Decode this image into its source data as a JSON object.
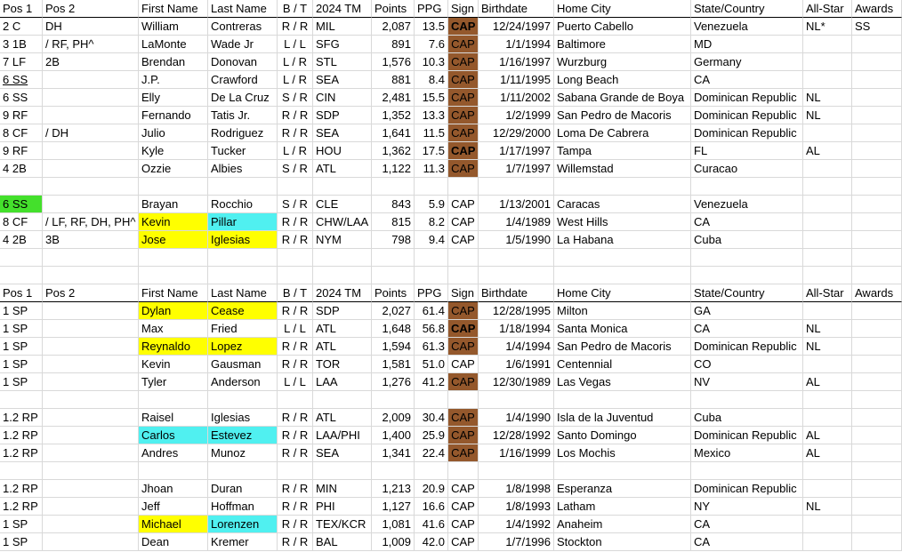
{
  "headers": [
    "Pos 1",
    "Pos 2",
    "First Name",
    "Last Name",
    "B / T",
    "2024 TM",
    "Points",
    "PPG",
    "Sign",
    "Birthdate",
    "Home City",
    "State/Country",
    "All-Star",
    "Awards"
  ],
  "colors": {
    "cap_fill": "#94582c",
    "yellow_highlight": "#ffff00",
    "cyan_highlight": "#50f0f0",
    "green_highlight": "#44e02c",
    "gridline": "#d9d9d9"
  },
  "section1_rows": [
    {
      "pos1": "2 C",
      "pos2": "DH",
      "first": "William",
      "last": "Contreras",
      "bt": "R / R",
      "tm": "MIL",
      "points": "2,087",
      "ppg": "13.5",
      "sign": "CAP",
      "birth": "12/24/1997",
      "city": "Puerto Cabello",
      "state": "Venezuela",
      "allstar": "NL*",
      "awards": "SS"
    },
    {
      "pos1": "3 1B",
      "pos2": "/ RF, PH^",
      "first": "LaMonte",
      "last": "Wade Jr",
      "bt": "L / L",
      "tm": "SFG",
      "points": "891",
      "ppg": "7.6",
      "sign": "CAP",
      "birth": "1/1/1994",
      "city": "Baltimore",
      "state": "MD",
      "allstar": "",
      "awards": ""
    },
    {
      "pos1": "7 LF",
      "pos2": "2B",
      "first": "Brendan",
      "last": "Donovan",
      "bt": "L / R",
      "tm": "STL",
      "points": "1,576",
      "ppg": "10.3",
      "sign": "CAP",
      "birth": "1/16/1997",
      "city": "Wurzburg",
      "state": "Germany",
      "allstar": "",
      "awards": ""
    },
    {
      "pos1": "6 SS",
      "pos2": "",
      "first": "J.P.",
      "last": "Crawford",
      "bt": "L / R",
      "tm": "SEA",
      "points": "881",
      "ppg": "8.4",
      "sign": "CAP",
      "birth": "1/11/1995",
      "city": "Long Beach",
      "state": "CA",
      "allstar": "",
      "awards": ""
    },
    {
      "pos1": "6 SS",
      "pos2": "",
      "first": "Elly",
      "last": "De La Cruz",
      "bt": "S / R",
      "tm": "CIN",
      "points": "2,481",
      "ppg": "15.5",
      "sign": "CAP",
      "birth": "1/11/2002",
      "city": "Sabana Grande de Boya",
      "state": "Dominican Republic",
      "allstar": "NL",
      "awards": ""
    },
    {
      "pos1": "9 RF",
      "pos2": "",
      "first": "Fernando",
      "last": "Tatis Jr.",
      "bt": "R / R",
      "tm": "SDP",
      "points": "1,352",
      "ppg": "13.3",
      "sign": "CAP",
      "birth": "1/2/1999",
      "city": "San Pedro de Macoris",
      "state": "Dominican Republic",
      "allstar": "NL",
      "awards": ""
    },
    {
      "pos1": "8 CF",
      "pos2": "/ DH",
      "first": "Julio",
      "last": "Rodriguez",
      "bt": "R / R",
      "tm": "SEA",
      "points": "1,641",
      "ppg": "11.5",
      "sign": "CAP",
      "birth": "12/29/2000",
      "city": "Loma De Cabrera",
      "state": "Dominican Republic",
      "allstar": "",
      "awards": ""
    },
    {
      "pos1": "9 RF",
      "pos2": "",
      "first": "Kyle",
      "last": "Tucker",
      "bt": "L / R",
      "tm": "HOU",
      "points": "1,362",
      "ppg": "17.5",
      "sign": "CAP",
      "birth": "1/17/1997",
      "city": "Tampa",
      "state": "FL",
      "allstar": "AL",
      "awards": ""
    },
    {
      "pos1": "4 2B",
      "pos2": "",
      "first": "Ozzie",
      "last": "Albies",
      "bt": "S / R",
      "tm": "ATL",
      "points": "1,122",
      "ppg": "11.3",
      "sign": "CAP",
      "birth": "1/7/1997",
      "city": "Willemstad",
      "state": "Curacao",
      "allstar": "",
      "awards": ""
    }
  ],
  "bench_rows": [
    {
      "pos1": "6 SS",
      "pos2": "",
      "first": "Brayan",
      "last": "Rocchio",
      "bt": "S / R",
      "tm": "CLE",
      "points": "843",
      "ppg": "5.9",
      "sign": "CAP",
      "birth": "1/13/2001",
      "city": "Caracas",
      "state": "Venezuela",
      "allstar": "",
      "awards": ""
    },
    {
      "pos1": "8 CF",
      "pos2": "/ LF, RF, DH, PH^",
      "first": "Kevin",
      "last": "Pillar",
      "bt": "R / R",
      "tm": "CHW/LAA",
      "points": "815",
      "ppg": "8.2",
      "sign": "CAP",
      "birth": "1/4/1989",
      "city": "West Hills",
      "state": "CA",
      "allstar": "",
      "awards": ""
    },
    {
      "pos1": "4 2B",
      "pos2": "3B",
      "first": "Jose",
      "last": "Iglesias",
      "bt": "R / R",
      "tm": "NYM",
      "points": "798",
      "ppg": "9.4",
      "sign": "CAP",
      "birth": "1/5/1990",
      "city": "La Habana",
      "state": "Cuba",
      "allstar": "",
      "awards": ""
    }
  ],
  "sp_rows": [
    {
      "pos1": "1 SP",
      "pos2": "",
      "first": "Dylan",
      "last": "Cease",
      "bt": "R / R",
      "tm": "SDP",
      "points": "2,027",
      "ppg": "61.4",
      "sign": "CAP",
      "birth": "12/28/1995",
      "city": "Milton",
      "state": "GA",
      "allstar": "",
      "awards": ""
    },
    {
      "pos1": "1 SP",
      "pos2": "",
      "first": "Max",
      "last": "Fried",
      "bt": "L / L",
      "tm": "ATL",
      "points": "1,648",
      "ppg": "56.8",
      "sign": "CAP",
      "birth": "1/18/1994",
      "city": "Santa Monica",
      "state": "CA",
      "allstar": "NL",
      "awards": ""
    },
    {
      "pos1": "1 SP",
      "pos2": "",
      "first": "Reynaldo",
      "last": "Lopez",
      "bt": "R / R",
      "tm": "ATL",
      "points": "1,594",
      "ppg": "61.3",
      "sign": "CAP",
      "birth": "1/4/1994",
      "city": "San Pedro de Macoris",
      "state": "Dominican Republic",
      "allstar": "NL",
      "awards": ""
    },
    {
      "pos1": "1 SP",
      "pos2": "",
      "first": "Kevin",
      "last": "Gausman",
      "bt": "R / R",
      "tm": "TOR",
      "points": "1,581",
      "ppg": "51.0",
      "sign": "CAP",
      "birth": "1/6/1991",
      "city": "Centennial",
      "state": "CO",
      "allstar": "",
      "awards": ""
    },
    {
      "pos1": "1 SP",
      "pos2": "",
      "first": "Tyler",
      "last": "Anderson",
      "bt": "L / L",
      "tm": "LAA",
      "points": "1,276",
      "ppg": "41.2",
      "sign": "CAP",
      "birth": "12/30/1989",
      "city": "Las Vegas",
      "state": "NV",
      "allstar": "AL",
      "awards": ""
    }
  ],
  "rp_rows": [
    {
      "pos1": "1.2 RP",
      "pos2": "",
      "first": "Raisel",
      "last": "Iglesias",
      "bt": "R / R",
      "tm": "ATL",
      "points": "2,009",
      "ppg": "30.4",
      "sign": "CAP",
      "birth": "1/4/1990",
      "city": "Isla de la Juventud",
      "state": "Cuba",
      "allstar": "",
      "awards": ""
    },
    {
      "pos1": "1.2 RP",
      "pos2": "",
      "first": "Carlos",
      "last": "Estevez",
      "bt": "R / R",
      "tm": "LAA/PHI",
      "points": "1,400",
      "ppg": "25.9",
      "sign": "CAP",
      "birth": "12/28/1992",
      "city": "Santo Domingo",
      "state": "Dominican Republic",
      "allstar": "AL",
      "awards": ""
    },
    {
      "pos1": "1.2 RP",
      "pos2": "",
      "first": "Andres",
      "last": "Munoz",
      "bt": "R / R",
      "tm": "SEA",
      "points": "1,341",
      "ppg": "22.4",
      "sign": "CAP",
      "birth": "1/16/1999",
      "city": "Los Mochis",
      "state": "Mexico",
      "allstar": "AL",
      "awards": ""
    }
  ],
  "bottom_rows": [
    {
      "pos1": "1.2 RP",
      "pos2": "",
      "first": "Jhoan",
      "last": "Duran",
      "bt": "R / R",
      "tm": "MIN",
      "points": "1,213",
      "ppg": "20.9",
      "sign": "CAP",
      "birth": "1/8/1998",
      "city": "Esperanza",
      "state": "Dominican Republic",
      "allstar": "",
      "awards": ""
    },
    {
      "pos1": "1.2 RP",
      "pos2": "",
      "first": "Jeff",
      "last": "Hoffman",
      "bt": "R / R",
      "tm": "PHI",
      "points": "1,127",
      "ppg": "16.6",
      "sign": "CAP",
      "birth": "1/8/1993",
      "city": "Latham",
      "state": "NY",
      "allstar": "NL",
      "awards": ""
    },
    {
      "pos1": "1 SP",
      "pos2": "",
      "first": "Michael",
      "last": "Lorenzen",
      "bt": "R / R",
      "tm": "TEX/KCR",
      "points": "1,081",
      "ppg": "41.6",
      "sign": "CAP",
      "birth": "1/4/1992",
      "city": "Anaheim",
      "state": "CA",
      "allstar": "",
      "awards": ""
    },
    {
      "pos1": "1 SP",
      "pos2": "",
      "first": "Dean",
      "last": "Kremer",
      "bt": "R / R",
      "tm": "BAL",
      "points": "1,009",
      "ppg": "42.0",
      "sign": "CAP",
      "birth": "1/7/1996",
      "city": "Stockton",
      "state": "CA",
      "allstar": "",
      "awards": ""
    }
  ]
}
